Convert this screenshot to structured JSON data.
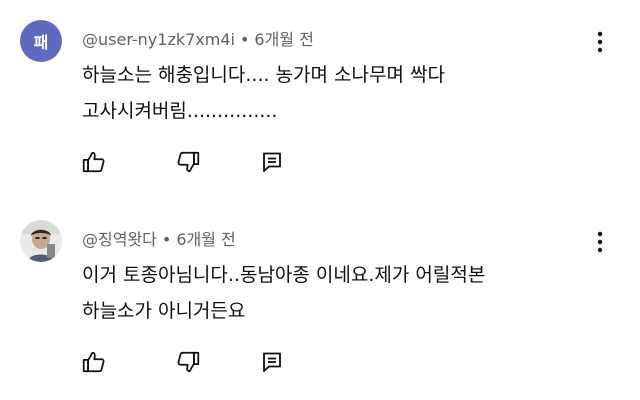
{
  "comments": [
    {
      "avatar_letter": "패",
      "avatar_color": "#5c6bc0",
      "username": "@user-ny1zk7xm4i",
      "separator": "•",
      "time": "6개월 전",
      "lines": [
        "하늘소는 해충입니다.... 농가며 소나무며 싹다",
        "고사시켜버림..............."
      ]
    },
    {
      "username": "@징역왓다",
      "separator": "•",
      "time": "6개월 전",
      "lines": [
        "이거 토종아님니다..동남아종 이네요.제가 어릴적본",
        "하늘소가 아니거든요"
      ]
    }
  ],
  "icons": {
    "like": "thumbs-up-icon",
    "dislike": "thumbs-down-icon",
    "reply": "reply-icon",
    "more": "more-vertical-icon"
  },
  "colors": {
    "text": "#0f0f0f",
    "meta": "#606060"
  }
}
